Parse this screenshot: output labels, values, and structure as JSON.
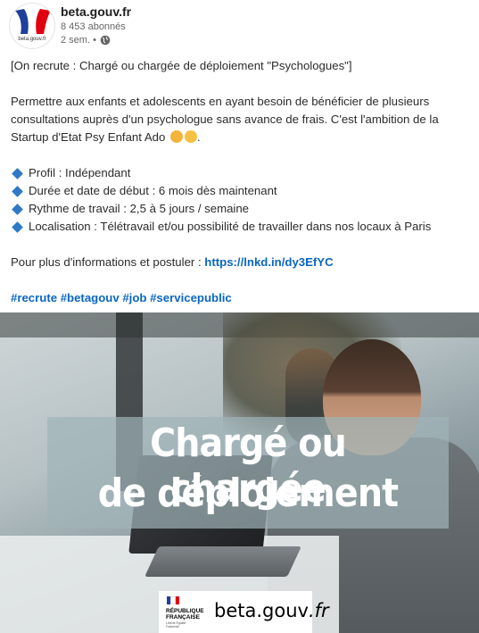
{
  "header": {
    "avatar_text": "beta.gouv.fr",
    "author": "beta.gouv.fr",
    "followers": "8 453 abonnés",
    "time": "2 sem. •",
    "visibility_icon": "globe-icon"
  },
  "post": {
    "title": "[On recrute : Chargé ou chargée de déploiement \"Psychologues\"]",
    "intro": "Permettre aux enfants et adolescents en ayant besoin de bénéficier de plusieurs consultations auprès d'un psychologue sans avance de frais. C'est l'ambition de la Startup d'Etat Psy Enfant Ado",
    "intro_end": ".",
    "bullets": [
      "Profil : Indépendant",
      "Durée et date de début : 6 mois dès maintenant",
      "Rythme de travail : 2,5 à 5 jours / semaine",
      "Localisation : Télétravail et/ou possibilité de travailler dans nos locaux à Paris"
    ],
    "more_info": "Pour plus d'informations et postuler : ",
    "link": "https://lnkd.in/dy3EfYC",
    "hashtags": "#recrute #betagouv #job #servicepublic"
  },
  "image": {
    "banner_line1": "Chargé ou chargée",
    "banner_line2": "de déploiement",
    "rf_line1": "RÉPUBLIQUE",
    "rf_line2": "FRANÇAISE",
    "rf_motto": "Liberté Égalité Fraternité",
    "logo_main": "beta.gouv",
    "logo_suffix": ".fr"
  },
  "colors": {
    "link": "#0a66c2",
    "bullet": "#2f79c6",
    "flag_blue": "#1f3f9a",
    "flag_red": "#e1000f"
  }
}
